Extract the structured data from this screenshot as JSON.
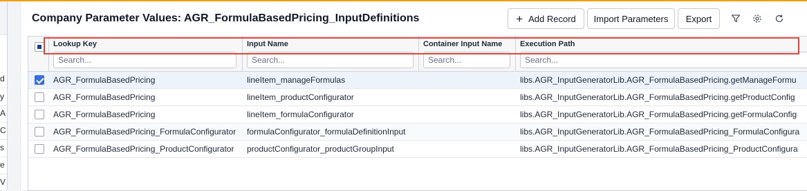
{
  "page": {
    "title": "Company Parameter Values: AGR_FormulaBasedPricing_InputDefinitions"
  },
  "toolbar": {
    "add_record_label": "Add Record",
    "import_label": "Import Parameters",
    "export_label": "Export",
    "add_icon": "plus-icon",
    "filter_icon": "filter-icon",
    "settings_icon": "gear-icon",
    "refresh_icon": "refresh-icon"
  },
  "left_pane": {
    "fragments": [
      "d",
      "y",
      "A",
      "C",
      "s",
      "e",
      "V"
    ]
  },
  "grid": {
    "columns": [
      {
        "label": "Lookup Key",
        "placeholder": "Search..."
      },
      {
        "label": "Input Name",
        "placeholder": "Search..."
      },
      {
        "label": "Container Input Name",
        "placeholder": "Search..."
      },
      {
        "label": "Execution Path",
        "placeholder": "Search..."
      }
    ],
    "rows": [
      {
        "selected": true,
        "lookup_key": "AGR_FormulaBasedPricing",
        "input_name": "lineItem_manageFormulas",
        "container_input_name": "",
        "execution_path": "libs.AGR_InputGeneratorLib.AGR_FormulaBasedPricing.getManageFormu"
      },
      {
        "selected": false,
        "lookup_key": "AGR_FormulaBasedPricing",
        "input_name": "lineItem_productConfigurator",
        "container_input_name": "",
        "execution_path": "libs.AGR_InputGeneratorLib.AGR_FormulaBasedPricing.getProductConfig"
      },
      {
        "selected": false,
        "lookup_key": "AGR_FormulaBasedPricing",
        "input_name": "lineItem_formulaConfigurator",
        "container_input_name": "",
        "execution_path": "libs.AGR_InputGeneratorLib.AGR_FormulaBasedPricing.getFormulaConfig"
      },
      {
        "selected": false,
        "lookup_key": "AGR_FormulaBasedPricing_FormulaConfigurator",
        "input_name": "formulaConfigurator_formulaDefinitionInput",
        "container_input_name": "",
        "execution_path": "libs.AGR_InputGeneratorLib.AGR_FormulaBasedPricing_FormulaConfigura"
      },
      {
        "selected": false,
        "lookup_key": "AGR_FormulaBasedPricing_ProductConfigurator",
        "input_name": "productConfigurator_productGroupInput",
        "container_input_name": "",
        "execution_path": "libs.AGR_InputGeneratorLib.AGR_FormulaBasedPricing_ProductConfigura"
      }
    ]
  },
  "colors": {
    "accent_line": "#f59e0b",
    "selection_outline": "#e0453a",
    "checkbox_checked": "#3b6fd8"
  }
}
